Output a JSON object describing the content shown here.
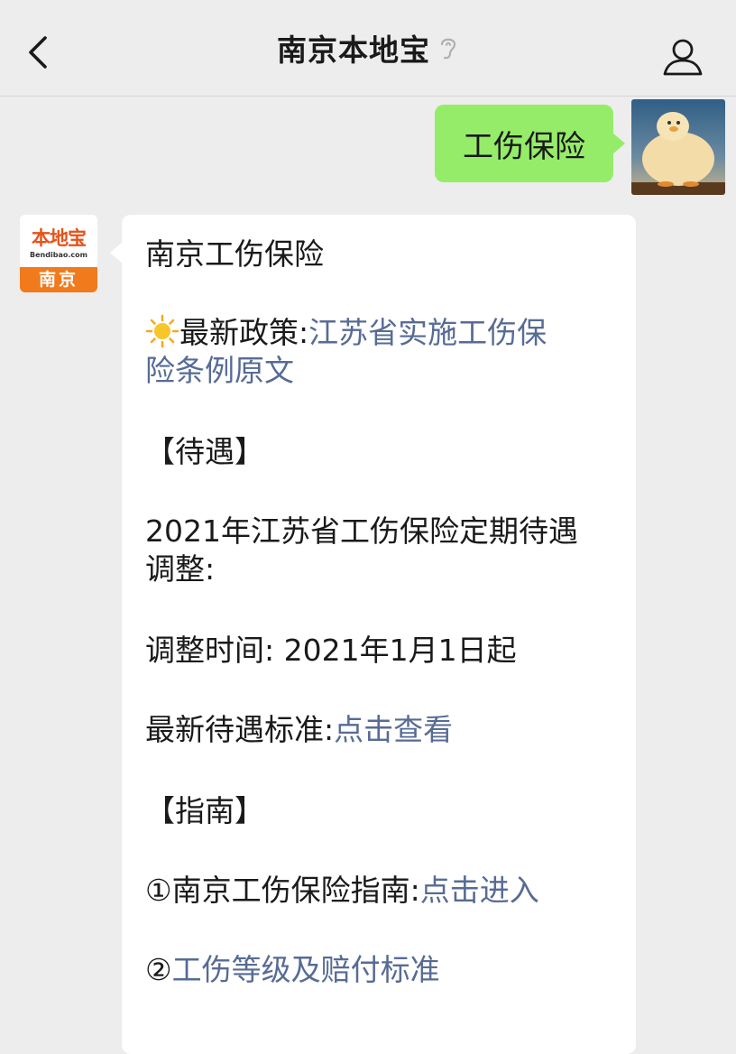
{
  "header": {
    "title": "南京本地宝"
  },
  "user_message": {
    "text": "工伤保险"
  },
  "bot_avatar": {
    "logo_text": "本地宝",
    "logo_sub": "Bendibao.com",
    "city": "南京"
  },
  "bot_message": {
    "heading": "南京工伤保险",
    "policy_label": "最新政策:",
    "policy_link_line1": "江苏省实施工伤保",
    "policy_link_line2": "险条例原文",
    "section_benefits": "【待遇】",
    "adjust_line1": "2021年江苏省工伤保险定期待遇",
    "adjust_line2": "调整:",
    "adjust_time": "调整时间:  2021年1月1日起",
    "standard_label": "最新待遇标准:",
    "standard_link": "点击查看",
    "section_guide": "【指南】",
    "guide1_label": "①南京工伤保险指南:",
    "guide1_link": "点击进入",
    "guide2_prefix": "②",
    "guide2_link": "工伤等级及赔付标准"
  }
}
